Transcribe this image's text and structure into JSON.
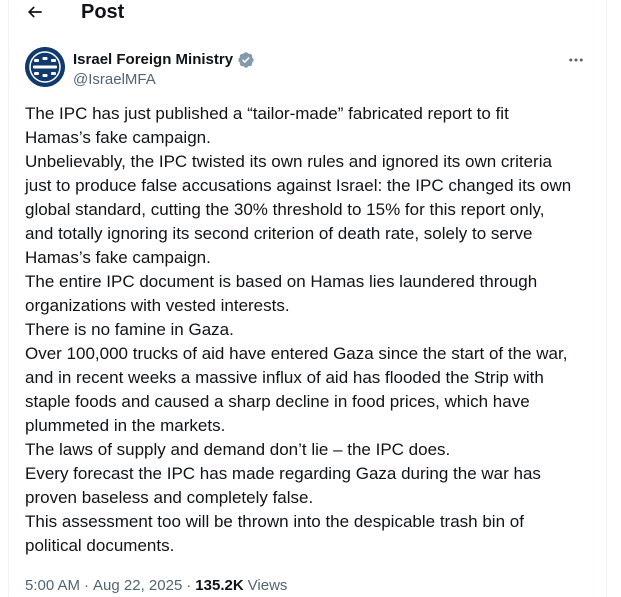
{
  "header": {
    "title": "Post"
  },
  "author": {
    "display_name": "Israel Foreign Ministry",
    "handle": "@IsraelMFA",
    "verified_badge_color": "#829aab"
  },
  "post": {
    "lines": [
      "The IPC has just published a “tailor-made” fabricated report to fit",
      "Hamas’s fake campaign.",
      "Unbelievably, the IPC twisted its own rules and ignored its own criteria",
      "just to produce false accusations against Israel: the IPC changed its own",
      "global standard, cutting the 30% threshold to 15% for this report only,",
      "and totally ignoring its second criterion of death rate, solely to serve",
      "Hamas’s fake campaign.",
      "The entire IPC document is based on Hamas lies laundered through",
      "organizations with vested interests.",
      "There is no famine in Gaza.",
      "Over 100,000 trucks of aid have entered Gaza since the start of the war,",
      "and in recent weeks a massive influx of aid has flooded the Strip with",
      "staple foods and caused a sharp decline in food prices, which have",
      "plummeted in the markets.",
      "The laws of supply and demand don’t lie – the IPC does.",
      "Every forecast the IPC has made regarding Gaza during the war has",
      "proven baseless and completely false.",
      "This assessment too will be thrown into the despicable trash bin of",
      "political documents."
    ]
  },
  "meta": {
    "time": "5:00 AM",
    "separator": "·",
    "date": "Aug 22, 2025",
    "views_count": "135.2K",
    "views_label": "Views"
  },
  "icons": {
    "back": "arrow-left-icon",
    "more": "more-horizontal-icon",
    "verified": "verified-badge-icon"
  }
}
